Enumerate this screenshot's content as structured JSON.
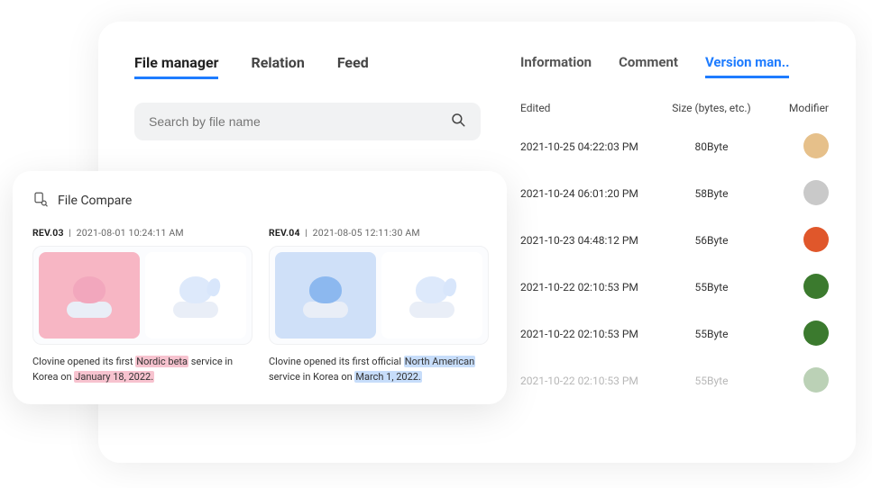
{
  "tabs": {
    "left": [
      "File manager",
      "Relation",
      "Feed"
    ],
    "left_active": 0,
    "right": [
      "Information",
      "Comment",
      "Version man.."
    ],
    "right_active": 2
  },
  "search": {
    "placeholder": "Search by file name"
  },
  "version_header": {
    "edited": "Edited",
    "size": "Size (bytes, etc.)",
    "modifier": "Modifier"
  },
  "versions": [
    {
      "edited": "2021-10-25 04:22:03 PM",
      "size": "80Byte",
      "avatar": "#e6c08a"
    },
    {
      "edited": "2021-10-24 06:01:20  PM",
      "size": "58Byte",
      "avatar": "#c9c9c9"
    },
    {
      "edited": "2021-10-23 04:48:12 PM",
      "size": "56Byte",
      "avatar": "#e0572b"
    },
    {
      "edited": "2021-10-22 02:10:53 PM",
      "size": "55Byte",
      "avatar": "#3b7a2e"
    },
    {
      "edited": "2021-10-22 02:10:53 PM",
      "size": "55Byte",
      "avatar": "#3b7a2e"
    },
    {
      "edited": "2021-10-22 02:10:53 PM",
      "size": "55Byte",
      "avatar": "#3b7a2e"
    }
  ],
  "compare": {
    "title": "File Compare",
    "left": {
      "rev": "REV.03",
      "ts": "2021-08-01 10:24:11 AM",
      "text_pre": "Clovine opened its first ",
      "text_hl1": "Nordic beta",
      "text_mid": " service in Korea on ",
      "text_hl2": "January 18, 2022.",
      "text_post": ""
    },
    "right": {
      "rev": "REV.04",
      "ts": "2021-08-05 12:11:30 AM",
      "text_pre": "Clovine opened its first official ",
      "text_hl1": "North American",
      "text_mid": " service in Korea on ",
      "text_hl2": "March 1, 2022.",
      "text_post": ""
    }
  }
}
